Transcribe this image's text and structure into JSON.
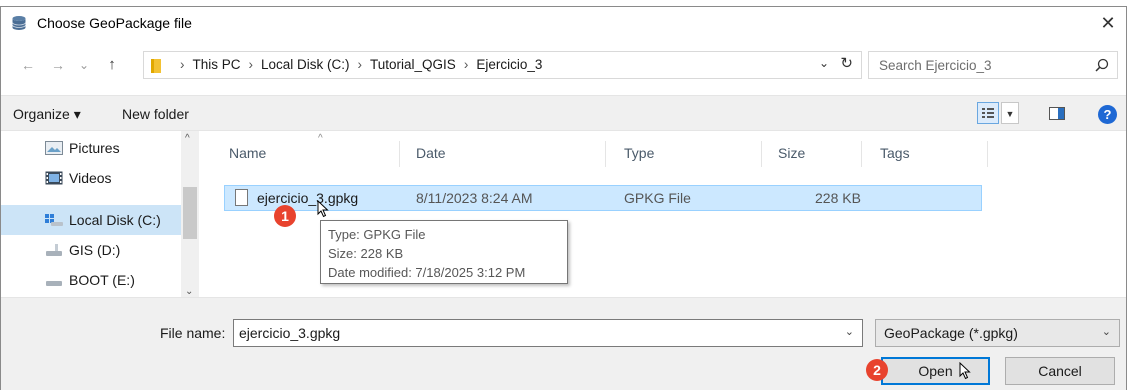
{
  "dialog": {
    "title": "Choose GeoPackage file",
    "close_glyph": "✕"
  },
  "nav": {
    "back_glyph": "←",
    "forward_glyph": "→",
    "recent_glyph": "⌄",
    "up_glyph": "↑"
  },
  "breadcrumbs": [
    "This PC",
    "Local Disk (C:)",
    "Tutorial_QGIS",
    "Ejercicio_3"
  ],
  "search": {
    "placeholder": "Search Ejercicio_3"
  },
  "toolbar": {
    "organize": "Organize ▾",
    "new_folder": "New folder",
    "help": "?"
  },
  "sidebar": {
    "items": [
      {
        "label": "Pictures",
        "icon": "pictures-icon"
      },
      {
        "label": "Videos",
        "icon": "videos-icon"
      },
      {
        "label": "Local Disk (C:)",
        "icon": "windows-drive-icon",
        "selected": true
      },
      {
        "label": "GIS (D:)",
        "icon": "drive-icon"
      },
      {
        "label": "BOOT (E:)",
        "icon": "drive-icon"
      }
    ]
  },
  "columns": [
    "Name",
    "Date",
    "Type",
    "Size",
    "Tags"
  ],
  "files": [
    {
      "name": "ejercicio_3.gpkg",
      "date": "8/11/2023 8:24 AM",
      "type": "GPKG File",
      "size": "228 KB",
      "tags": ""
    }
  ],
  "tooltip": {
    "type": "Type: GPKG File",
    "size": "Size: 228 KB",
    "modified": "Date modified: 7/18/2025 3:12 PM"
  },
  "annotations": {
    "step1": "1",
    "step2": "2",
    "color": "#e8432e"
  },
  "footer": {
    "file_name_label": "File name:",
    "file_name_value": "ejercicio_3.gpkg",
    "filter": "GeoPackage (*.gpkg)",
    "open": "Open",
    "cancel": "Cancel"
  },
  "colors": {
    "selection": "#cce8ff",
    "accent": "#0078d7"
  }
}
